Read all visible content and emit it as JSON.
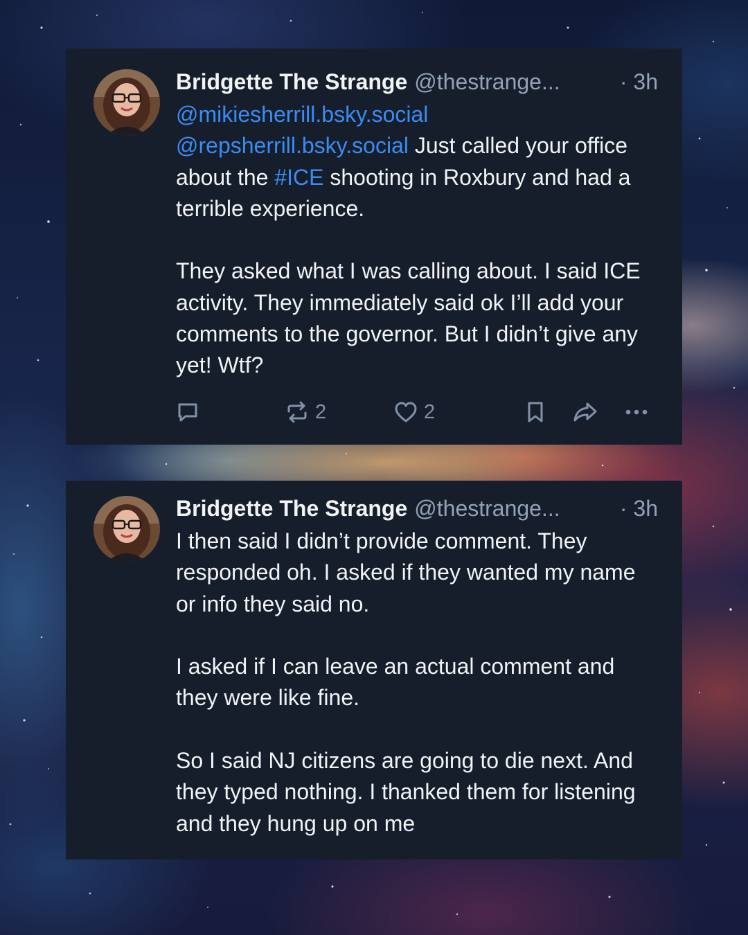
{
  "posts": [
    {
      "author_name": "Bridgette The Strange",
      "handle": "@thestrange...",
      "timestamp": "· 3h",
      "mention_1": "@mikiesherrill.bsky.social",
      "mention_2": "@repsherrill.bsky.social",
      "text_1": " Just called your office about the ",
      "hashtag": "#ICE",
      "text_2": " shooting in Roxbury and had a terrible experience.",
      "paragraph_2": "They asked what I was calling about. I said ICE activity. They immediately said ok I’ll add your comments to the governor. But I didn’t give any yet! Wtf?",
      "actions": {
        "reply_icon": "reply-icon",
        "repost_icon": "repost-icon",
        "repost_count": "2",
        "like_icon": "heart-icon",
        "like_count": "2",
        "bookmark_icon": "bookmark-icon",
        "share_icon": "share-icon",
        "more_icon": "more-icon"
      }
    },
    {
      "author_name": "Bridgette The Strange",
      "handle": "@thestrange...",
      "timestamp": "· 3h",
      "paragraphs": [
        "I then said I didn’t provide comment. They responded oh. I asked if they wanted my name or info they said no.",
        "I asked if I can leave an actual comment and they were like fine.",
        "So I said NJ citizens are going to die next. And they typed nothing. I thanked them for listening and they hung up on me"
      ]
    }
  ],
  "colors": {
    "card_background": "#161e2c",
    "text": "#f1f3f5",
    "muted": "#93a2b6",
    "link": "#3b8cf2",
    "icon": "#8191a7"
  }
}
